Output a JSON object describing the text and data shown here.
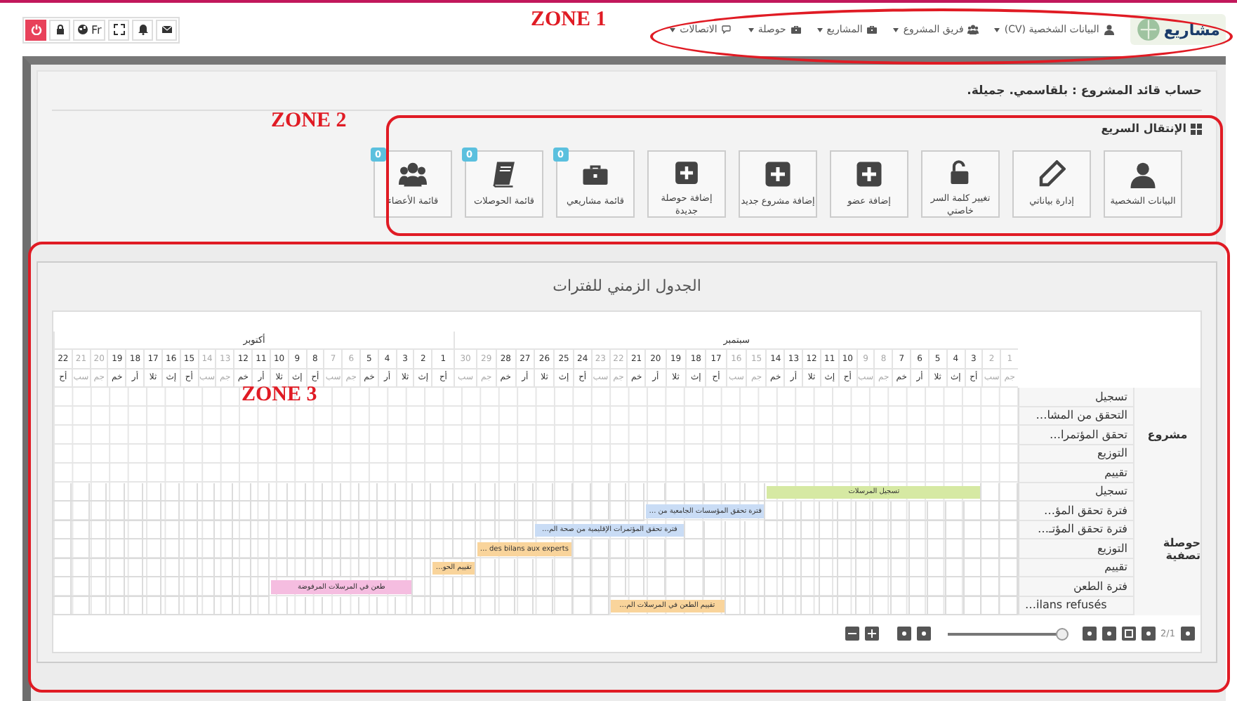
{
  "top_bar": {
    "language": "Fr",
    "logo_text": "مشاريع",
    "nav": [
      {
        "label": "البيانات الشخصية (CV)",
        "kind": "user"
      },
      {
        "label": "فريق المشروع",
        "kind": "users"
      },
      {
        "label": "المشاريع",
        "kind": "briefcase"
      },
      {
        "label": "حوصلة",
        "kind": "briefcase"
      },
      {
        "label": "الاتصالات",
        "kind": "comments"
      }
    ]
  },
  "breadcrumb": "حساب قائد المشروع : بلقاسمي. جميلة.",
  "quick_access": {
    "title": "الإنتقال السريع",
    "tiles": [
      {
        "label": "البيانات الشخصية",
        "kind": "user"
      },
      {
        "label": "إدارة بياناتي",
        "kind": "pencil"
      },
      {
        "label": "تغيير كلمة السر خاصتي",
        "kind": "unlock"
      },
      {
        "label": "إضافة عضو",
        "kind": "plus"
      },
      {
        "label": "إضافة مشروع جديد",
        "kind": "plus"
      },
      {
        "label": "إضافة حوصلة جديدة",
        "kind": "plus"
      },
      {
        "label": "قائمة مشاريعي",
        "kind": "briefcase",
        "badge": "0"
      },
      {
        "label": "قائمة الحوصلات",
        "kind": "book",
        "badge": "0"
      },
      {
        "label": "قائمة الأعضاء",
        "kind": "users",
        "badge": "0"
      }
    ]
  },
  "timeline": {
    "title": "الجدول الزمني للفترات",
    "months": [
      {
        "name": "سبتمبر",
        "days": [
          {
            "day": "1",
            "weekday": "جم",
            "weekend": true
          },
          {
            "day": "2",
            "weekday": "سب",
            "weekend": true
          },
          {
            "day": "3",
            "weekday": "أح",
            "weekend": false
          },
          {
            "day": "4",
            "weekday": "إث",
            "weekend": false
          },
          {
            "day": "5",
            "weekday": "ثلا",
            "weekend": false
          },
          {
            "day": "6",
            "weekday": "أر",
            "weekend": false
          },
          {
            "day": "7",
            "weekday": "خم",
            "weekend": false
          },
          {
            "day": "8",
            "weekday": "جم",
            "weekend": true
          },
          {
            "day": "9",
            "weekday": "سب",
            "weekend": true
          },
          {
            "day": "10",
            "weekday": "أح",
            "weekend": false
          },
          {
            "day": "11",
            "weekday": "إث",
            "weekend": false
          },
          {
            "day": "12",
            "weekday": "ثلا",
            "weekend": false
          },
          {
            "day": "13",
            "weekday": "أر",
            "weekend": false
          },
          {
            "day": "14",
            "weekday": "خم",
            "weekend": false
          },
          {
            "day": "15",
            "weekday": "جم",
            "weekend": true
          },
          {
            "day": "16",
            "weekday": "سب",
            "weekend": true
          },
          {
            "day": "17",
            "weekday": "أح",
            "weekend": false
          },
          {
            "day": "18",
            "weekday": "إث",
            "weekend": false
          },
          {
            "day": "19",
            "weekday": "ثلا",
            "weekend": false
          },
          {
            "day": "20",
            "weekday": "أر",
            "weekend": false
          },
          {
            "day": "21",
            "weekday": "خم",
            "weekend": false
          },
          {
            "day": "22",
            "weekday": "جم",
            "weekend": true
          },
          {
            "day": "23",
            "weekday": "سب",
            "weekend": true
          },
          {
            "day": "24",
            "weekday": "أح",
            "weekend": false
          },
          {
            "day": "25",
            "weekday": "إث",
            "weekend": false
          },
          {
            "day": "26",
            "weekday": "ثلا",
            "weekend": false
          },
          {
            "day": "27",
            "weekday": "أر",
            "weekend": false
          },
          {
            "day": "28",
            "weekday": "خم",
            "weekend": false
          },
          {
            "day": "29",
            "weekday": "جم",
            "weekend": true
          },
          {
            "day": "30",
            "weekday": "سب",
            "weekend": true
          }
        ]
      },
      {
        "name": "أكتوبر",
        "days": [
          {
            "day": "1",
            "weekday": "أح",
            "weekend": false
          },
          {
            "day": "2",
            "weekday": "إث",
            "weekend": false
          },
          {
            "day": "3",
            "weekday": "ثلا",
            "weekend": false
          },
          {
            "day": "4",
            "weekday": "أر",
            "weekend": false
          },
          {
            "day": "5",
            "weekday": "خم",
            "weekend": false
          },
          {
            "day": "6",
            "weekday": "جم",
            "weekend": true
          },
          {
            "day": "7",
            "weekday": "سب",
            "weekend": true
          },
          {
            "day": "8",
            "weekday": "أح",
            "weekend": false
          },
          {
            "day": "9",
            "weekday": "إث",
            "weekend": false
          },
          {
            "day": "10",
            "weekday": "ثلا",
            "weekend": false
          },
          {
            "day": "11",
            "weekday": "أر",
            "weekend": false
          },
          {
            "day": "12",
            "weekday": "خم",
            "weekend": false
          },
          {
            "day": "13",
            "weekday": "جم",
            "weekend": true
          },
          {
            "day": "14",
            "weekday": "سب",
            "weekend": true
          },
          {
            "day": "15",
            "weekday": "أح",
            "weekend": false
          },
          {
            "day": "16",
            "weekday": "إث",
            "weekend": false
          },
          {
            "day": "17",
            "weekday": "ثلا",
            "weekend": false
          },
          {
            "day": "18",
            "weekday": "أر",
            "weekend": false
          },
          {
            "day": "19",
            "weekday": "خم",
            "weekend": false
          },
          {
            "day": "20",
            "weekday": "جم",
            "weekend": true
          },
          {
            "day": "21",
            "weekday": "سب",
            "weekend": true
          },
          {
            "day": "22",
            "weekday": "أح",
            "weekend": false
          }
        ]
      }
    ],
    "groups": [
      {
        "name": "مشروع",
        "tasks": [
          {
            "label": "تسجيل"
          },
          {
            "label": "التحقق من المشا…"
          },
          {
            "label": "تحقق المؤتمرا…"
          },
          {
            "label": "التوزيع"
          },
          {
            "label": "تقييم"
          }
        ]
      },
      {
        "name": "حوصلة تصفية",
        "tasks": [
          {
            "label": "تسجيل",
            "bar": {
              "text": "تسجيل المرسلات",
              "color": "#d6e9a3",
              "days": [
                {
                  "on": false
                },
                {
                  "on": false
                },
                {
                  "on": true
                },
                {
                  "on": true
                },
                {
                  "on": true
                },
                {
                  "on": true
                },
                {
                  "on": true
                },
                {
                  "on": true
                },
                {
                  "on": true
                },
                {
                  "on": true
                },
                {
                  "on": true
                },
                {
                  "on": true
                },
                {
                  "on": true
                },
                {
                  "on": true
                },
                {
                  "on": false
                },
                {
                  "on": false
                },
                {
                  "on": false
                },
                {
                  "on": false
                },
                {
                  "on": false
                },
                {
                  "on": false
                },
                {
                  "on": false
                },
                {
                  "on": false
                },
                {
                  "on": false
                },
                {
                  "on": false
                },
                {
                  "on": false
                },
                {
                  "on": false
                },
                {
                  "on": false
                },
                {
                  "on": false
                },
                {
                  "on": false
                },
                {
                  "on": false
                },
                {
                  "on": false
                },
                {
                  "on": false
                },
                {
                  "on": false
                },
                {
                  "on": false
                },
                {
                  "on": false
                },
                {
                  "on": false
                },
                {
                  "on": false
                },
                {
                  "on": false
                },
                {
                  "on": false
                },
                {
                  "on": false
                },
                {
                  "on": false
                },
                {
                  "on": false
                },
                {
                  "on": false
                },
                {
                  "on": false
                },
                {
                  "on": false
                },
                {
                  "on": false
                },
                {
                  "on": false
                },
                {
                  "on": false
                },
                {
                  "on": false
                },
                {
                  "on": false
                },
                {
                  "on": false
                },
                {
                  "on": false
                }
              ]
            }
          },
          {
            "label": "فترة تحقق المؤ…",
            "bar": {
              "text": "فترة تحقق المؤسسات الجامعية من …",
              "color": "#c9dcf5",
              "days": [
                {
                  "on": false
                },
                {
                  "on": false
                },
                {
                  "on": false
                },
                {
                  "on": false
                },
                {
                  "on": false
                },
                {
                  "on": false
                },
                {
                  "on": false
                },
                {
                  "on": false
                },
                {
                  "on": false
                },
                {
                  "on": false
                },
                {
                  "on": false
                },
                {
                  "on": false
                },
                {
                  "on": false
                },
                {
                  "on": false
                },
                {
                  "on": true
                },
                {
                  "on": true
                },
                {
                  "on": true
                },
                {
                  "on": true
                },
                {
                  "on": true
                },
                {
                  "on": true
                },
                {
                  "on": false
                },
                {
                  "on": false
                },
                {
                  "on": false
                },
                {
                  "on": false
                },
                {
                  "on": false
                },
                {
                  "on": false
                },
                {
                  "on": false
                },
                {
                  "on": false
                },
                {
                  "on": false
                },
                {
                  "on": false
                },
                {
                  "on": false
                },
                {
                  "on": false
                },
                {
                  "on": false
                },
                {
                  "on": false
                },
                {
                  "on": false
                },
                {
                  "on": false
                },
                {
                  "on": false
                },
                {
                  "on": false
                },
                {
                  "on": false
                },
                {
                  "on": false
                },
                {
                  "on": false
                },
                {
                  "on": false
                },
                {
                  "on": false
                },
                {
                  "on": false
                },
                {
                  "on": false
                },
                {
                  "on": false
                },
                {
                  "on": false
                },
                {
                  "on": false
                },
                {
                  "on": false
                },
                {
                  "on": false
                },
                {
                  "on": false
                },
                {
                  "on": false
                }
              ]
            }
          },
          {
            "label": "فترة تحقق المؤتـ…",
            "bar": {
              "text": "فترة تحقق المؤتمرات الإقليمية من صحة الم…",
              "color": "#c9dcf5",
              "days": [
                {
                  "on": false
                },
                {
                  "on": false
                },
                {
                  "on": false
                },
                {
                  "on": false
                },
                {
                  "on": false
                },
                {
                  "on": false
                },
                {
                  "on": false
                },
                {
                  "on": false
                },
                {
                  "on": false
                },
                {
                  "on": false
                },
                {
                  "on": false
                },
                {
                  "on": false
                },
                {
                  "on": false
                },
                {
                  "on": false
                },
                {
                  "on": false
                },
                {
                  "on": false
                },
                {
                  "on": false
                },
                {
                  "on": false
                },
                {
                  "on": true
                },
                {
                  "on": true
                },
                {
                  "on": true
                },
                {
                  "on": true
                },
                {
                  "on": true
                },
                {
                  "on": true
                },
                {
                  "on": true
                },
                {
                  "on": true
                },
                {
                  "on": false
                },
                {
                  "on": false
                },
                {
                  "on": false
                },
                {
                  "on": false
                },
                {
                  "on": false
                },
                {
                  "on": false
                },
                {
                  "on": false
                },
                {
                  "on": false
                },
                {
                  "on": false
                },
                {
                  "on": false
                },
                {
                  "on": false
                },
                {
                  "on": false
                },
                {
                  "on": false
                },
                {
                  "on": false
                },
                {
                  "on": false
                },
                {
                  "on": false
                },
                {
                  "on": false
                },
                {
                  "on": false
                },
                {
                  "on": false
                },
                {
                  "on": false
                },
                {
                  "on": false
                },
                {
                  "on": false
                },
                {
                  "on": false
                },
                {
                  "on": false
                },
                {
                  "on": false
                },
                {
                  "on": false
                }
              ]
            }
          },
          {
            "label": "التوزيع",
            "bar": {
              "text": "… des bilans aux experts",
              "color": "#f9d49b",
              "days": [
                {
                  "on": false
                },
                {
                  "on": false
                },
                {
                  "on": false
                },
                {
                  "on": false
                },
                {
                  "on": false
                },
                {
                  "on": false
                },
                {
                  "on": false
                },
                {
                  "on": false
                },
                {
                  "on": false
                },
                {
                  "on": false
                },
                {
                  "on": false
                },
                {
                  "on": false
                },
                {
                  "on": false
                },
                {
                  "on": false
                },
                {
                  "on": false
                },
                {
                  "on": false
                },
                {
                  "on": false
                },
                {
                  "on": false
                },
                {
                  "on": false
                },
                {
                  "on": false
                },
                {
                  "on": false
                },
                {
                  "on": false
                },
                {
                  "on": false
                },
                {
                  "on": false
                },
                {
                  "on": true
                },
                {
                  "on": true
                },
                {
                  "on": true
                },
                {
                  "on": true
                },
                {
                  "on": true
                },
                {
                  "on": false
                },
                {
                  "on": false
                },
                {
                  "on": false
                },
                {
                  "on": false
                },
                {
                  "on": false
                },
                {
                  "on": false
                },
                {
                  "on": false
                },
                {
                  "on": false
                },
                {
                  "on": false
                },
                {
                  "on": false
                },
                {
                  "on": false
                },
                {
                  "on": false
                },
                {
                  "on": false
                },
                {
                  "on": false
                },
                {
                  "on": false
                },
                {
                  "on": false
                },
                {
                  "on": false
                },
                {
                  "on": false
                },
                {
                  "on": false
                },
                {
                  "on": false
                },
                {
                  "on": false
                },
                {
                  "on": false
                },
                {
                  "on": false
                }
              ]
            }
          },
          {
            "label": "تقييم",
            "bar": {
              "text": "تقييم الحو…",
              "color": "#f9d49b",
              "days": [
                {
                  "on": false
                },
                {
                  "on": false
                },
                {
                  "on": false
                },
                {
                  "on": false
                },
                {
                  "on": false
                },
                {
                  "on": false
                },
                {
                  "on": false
                },
                {
                  "on": false
                },
                {
                  "on": false
                },
                {
                  "on": false
                },
                {
                  "on": false
                },
                {
                  "on": false
                },
                {
                  "on": false
                },
                {
                  "on": false
                },
                {
                  "on": false
                },
                {
                  "on": false
                },
                {
                  "on": false
                },
                {
                  "on": false
                },
                {
                  "on": false
                },
                {
                  "on": false
                },
                {
                  "on": false
                },
                {
                  "on": false
                },
                {
                  "on": false
                },
                {
                  "on": false
                },
                {
                  "on": false
                },
                {
                  "on": false
                },
                {
                  "on": false
                },
                {
                  "on": false
                },
                {
                  "on": false
                },
                {
                  "on": true
                },
                {
                  "on": true
                },
                {
                  "on": false
                },
                {
                  "on": false
                },
                {
                  "on": false
                },
                {
                  "on": false
                },
                {
                  "on": false
                },
                {
                  "on": false
                },
                {
                  "on": false
                },
                {
                  "on": false
                },
                {
                  "on": false
                },
                {
                  "on": false
                },
                {
                  "on": false
                },
                {
                  "on": false
                },
                {
                  "on": false
                },
                {
                  "on": false
                },
                {
                  "on": false
                },
                {
                  "on": false
                },
                {
                  "on": false
                },
                {
                  "on": false
                },
                {
                  "on": false
                },
                {
                  "on": false
                },
                {
                  "on": false
                }
              ]
            }
          },
          {
            "label": "فترة الطعن",
            "bar": {
              "text": "طعن في المرسلات المرفوضة",
              "color": "#f5bde0",
              "days": [
                {
                  "on": false
                },
                {
                  "on": false
                },
                {
                  "on": false
                },
                {
                  "on": false
                },
                {
                  "on": false
                },
                {
                  "on": false
                },
                {
                  "on": false
                },
                {
                  "on": false
                },
                {
                  "on": false
                },
                {
                  "on": false
                },
                {
                  "on": false
                },
                {
                  "on": false
                },
                {
                  "on": false
                },
                {
                  "on": false
                },
                {
                  "on": false
                },
                {
                  "on": false
                },
                {
                  "on": false
                },
                {
                  "on": false
                },
                {
                  "on": false
                },
                {
                  "on": false
                },
                {
                  "on": false
                },
                {
                  "on": false
                },
                {
                  "on": false
                },
                {
                  "on": false
                },
                {
                  "on": false
                },
                {
                  "on": false
                },
                {
                  "on": false
                },
                {
                  "on": false
                },
                {
                  "on": false
                },
                {
                  "on": false
                },
                {
                  "on": false
                },
                {
                  "on": false
                },
                {
                  "on": true
                },
                {
                  "on": true
                },
                {
                  "on": true
                },
                {
                  "on": true
                },
                {
                  "on": true
                },
                {
                  "on": true
                },
                {
                  "on": true
                },
                {
                  "on": true
                },
                {
                  "on": false
                },
                {
                  "on": false
                },
                {
                  "on": false
                },
                {
                  "on": false
                },
                {
                  "on": false
                },
                {
                  "on": false
                },
                {
                  "on": false
                },
                {
                  "on": false
                },
                {
                  "on": false
                },
                {
                  "on": false
                },
                {
                  "on": false
                },
                {
                  "on": false
                }
              ]
            }
          },
          {
            "label": "…ilans refusés",
            "bar": {
              "text": "تقييم الطعن في المرسلات الم…",
              "color": "#f9d49b",
              "days": [
                {
                  "on": false
                },
                {
                  "on": false
                },
                {
                  "on": false
                },
                {
                  "on": false
                },
                {
                  "on": false
                },
                {
                  "on": false
                },
                {
                  "on": false
                },
                {
                  "on": false
                },
                {
                  "on": false
                },
                {
                  "on": false
                },
                {
                  "on": false
                },
                {
                  "on": false
                },
                {
                  "on": false
                },
                {
                  "on": false
                },
                {
                  "on": false
                },
                {
                  "on": false
                },
                {
                  "on": true
                },
                {
                  "on": true
                },
                {
                  "on": true
                },
                {
                  "on": true
                },
                {
                  "on": true
                },
                {
                  "on": true
                },
                {
                  "on": false
                },
                {
                  "on": false
                },
                {
                  "on": false
                },
                {
                  "on": false
                },
                {
                  "on": false
                },
                {
                  "on": false
                },
                {
                  "on": false
                },
                {
                  "on": false
                },
                {
                  "on": false
                },
                {
                  "on": false
                },
                {
                  "on": false
                },
                {
                  "on": false
                },
                {
                  "on": false
                },
                {
                  "on": false
                },
                {
                  "on": false
                },
                {
                  "on": false
                },
                {
                  "on": false
                },
                {
                  "on": false
                },
                {
                  "on": false
                },
                {
                  "on": false
                },
                {
                  "on": false
                },
                {
                  "on": false
                },
                {
                  "on": false
                },
                {
                  "on": false
                },
                {
                  "on": false
                },
                {
                  "on": false
                },
                {
                  "on": false
                },
                {
                  "on": false
                },
                {
                  "on": false
                },
                {
                  "on": false
                }
              ]
            }
          }
        ]
      }
    ],
    "zoom_slider": {
      "level": 0.97
    },
    "pager": "2/1"
  },
  "annotations": [
    {
      "label": "ZONE 1"
    },
    {
      "label": "ZONE 2"
    },
    {
      "label": "ZONE 3"
    }
  ]
}
